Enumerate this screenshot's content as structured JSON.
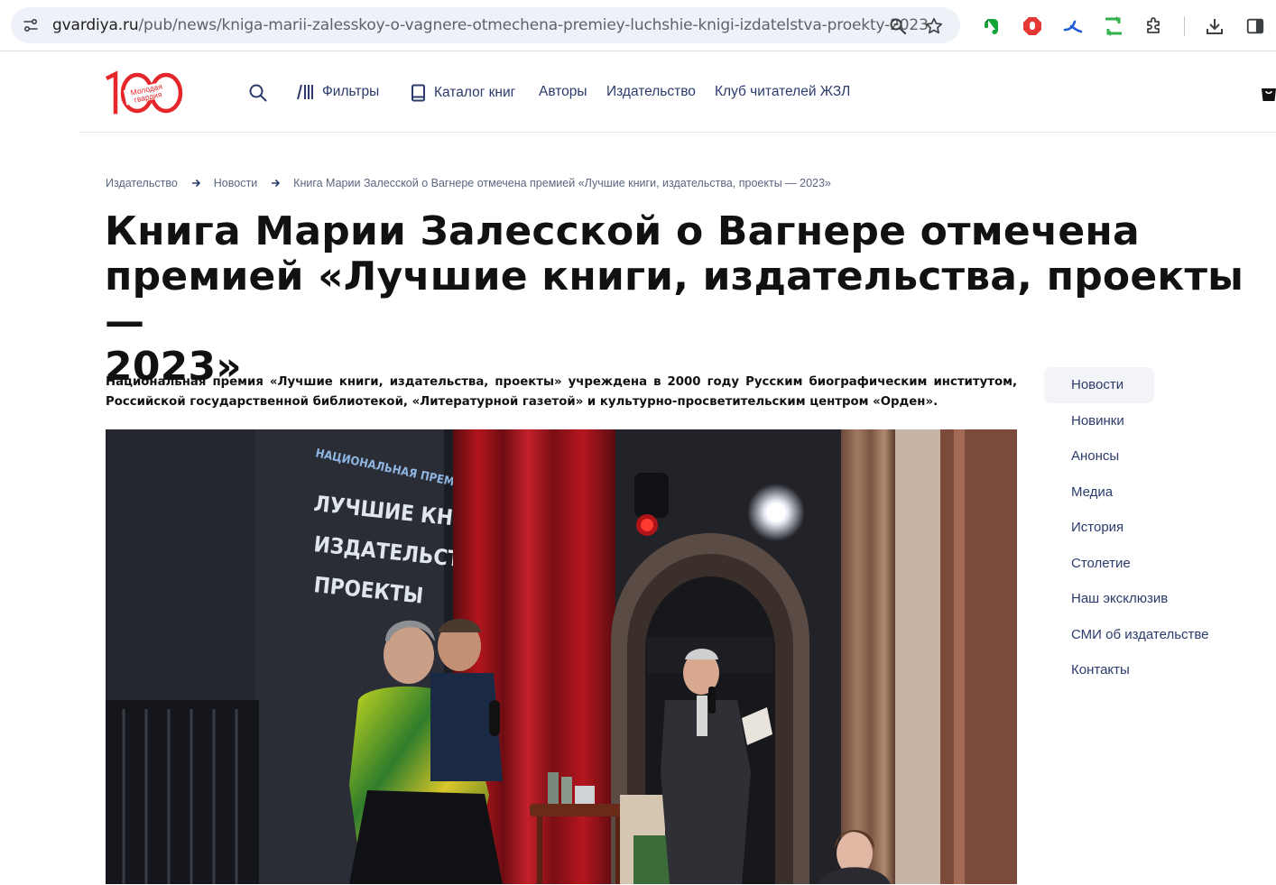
{
  "browser": {
    "url_host": "gvardiya.ru",
    "url_path": "/pub/news/kniga-marii-zalesskoy-o-vagnere-otmechena-premiey-luchshie-knigi-izdatelstva-proekty-2023",
    "icons": [
      "site-info-icon",
      "zoom-icon",
      "bookmark-star-icon",
      "evernote-icon",
      "adblock-icon",
      "translator-icon",
      "sync-icon",
      "extensions-icon",
      "downloads-icon",
      "side-panel-icon"
    ]
  },
  "header": {
    "logo_text": "Молодая гвардия",
    "logo_number": "100",
    "nav": {
      "filters": "Фильтры",
      "catalog": "Каталог книг",
      "authors": "Авторы",
      "publisher": "Издательство",
      "club": "Клуб читателей ЖЗЛ"
    }
  },
  "breadcrumb": {
    "items": [
      "Издательство",
      "Новости",
      "Книга Марии Залесской о Вагнере отмечена премией «Лучшие книги, издательства, проекты — 2023»"
    ]
  },
  "article": {
    "title_lines": [
      "Книга Марии Залесской о Вагнере отмечена",
      "премией «Лучшие книги, издательства, проекты —",
      "2023»"
    ],
    "lead": "Национальная премия «Лучшие книги, издательства, проекты» учреждена в 2000 году Русским биографическим институтом, Российской государственной библиотекой, «Литературной газетой» и культурно-просветительским центром «Орден».",
    "photo_screen_text": [
      "НАЦИОНАЛЬНАЯ ПРЕМИЯ",
      "ЛУЧШИЕ КНИГИ",
      "ИЗДАТЕЛЬСТВА",
      "ПРОЕКТЫ"
    ]
  },
  "sidebar": {
    "active": "Новости",
    "items": [
      "Новости",
      "Новинки",
      "Анонсы",
      "Медиа",
      "История",
      "Столетие",
      "Наш эксклюзив",
      "СМИ об издательстве",
      "Контакты"
    ]
  },
  "colors": {
    "brand_red": "#e5262a",
    "nav_text": "#2b3b6b",
    "omnibox_bg": "#eef1f7"
  }
}
